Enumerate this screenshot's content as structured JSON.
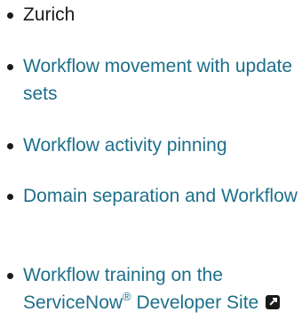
{
  "items": [
    {
      "text": "Zurich"
    },
    {
      "text": "Workflow movement with update sets"
    },
    {
      "text": "Workflow activity pinning"
    },
    {
      "text": "Domain separation and Workflow"
    },
    {
      "text_before": "Workflow training on the ServiceNow",
      "reg": "®",
      "text_after": " Developer Site"
    }
  ],
  "colors": {
    "link": "#1d6f8a",
    "text": "#1a1a1a"
  },
  "icons": {
    "external": "external-link-icon"
  }
}
